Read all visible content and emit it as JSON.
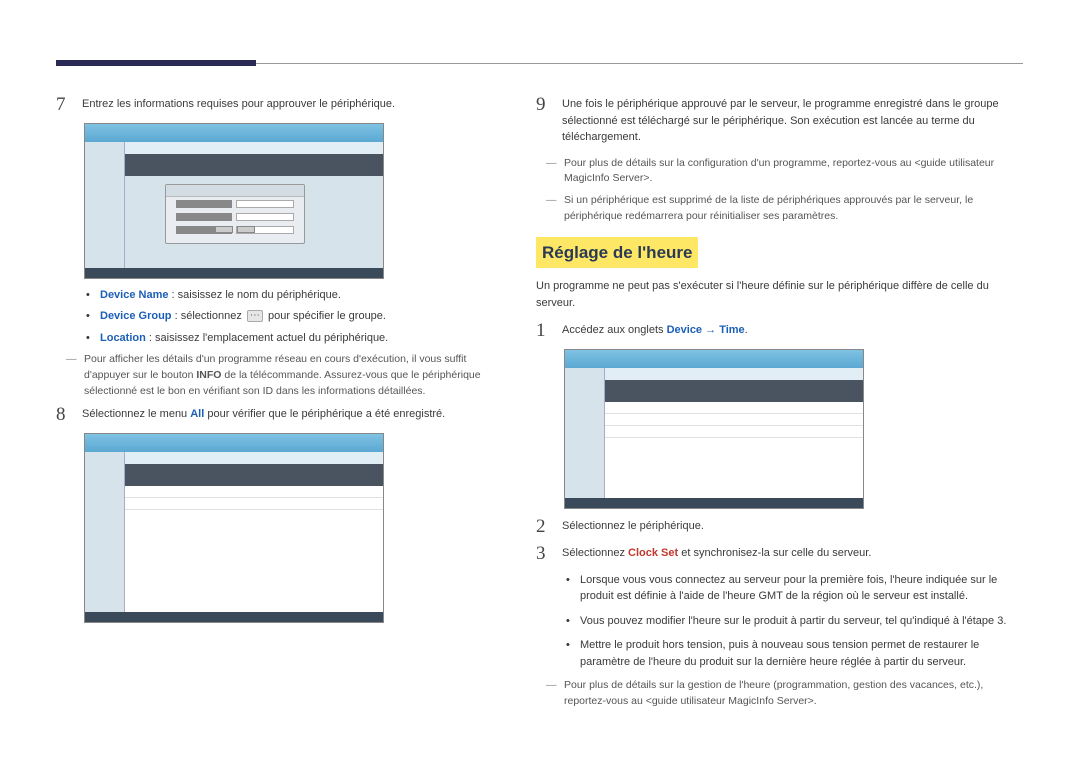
{
  "left": {
    "step7": {
      "num": "7",
      "text": "Entrez les informations requises pour approuver le périphérique."
    },
    "bullets7": [
      {
        "label": "Device Name",
        "rest": " : saisissez le nom du périphérique."
      },
      {
        "label": "Device Group",
        "rest_pre": " : sélectionnez ",
        "rest_post": " pour spécifier le groupe."
      },
      {
        "label": "Location",
        "rest": " : saisissez l'emplacement actuel du périphérique."
      }
    ],
    "note7": "Pour afficher les détails d'un programme réseau en cours d'exécution, il vous suffit d'appuyer sur le bouton INFO de la télécommande. Assurez-vous que le périphérique sélectionné est le bon en vérifiant son ID dans les informations détaillées.",
    "note7_bold": "INFO",
    "step8": {
      "num": "8",
      "text_pre": "Sélectionnez le menu ",
      "text_link": "All",
      "text_post": " pour vérifier que le périphérique a été enregistré."
    }
  },
  "right": {
    "step9": {
      "num": "9",
      "text": "Une fois le périphérique approuvé par le serveur, le programme enregistré dans le groupe sélectionné est téléchargé sur le périphérique. Son exécution est lancée au terme du téléchargement."
    },
    "note9a": "Pour plus de détails sur la configuration d'un programme, reportez-vous au <guide utilisateur MagicInfo Server>.",
    "note9b": "Si un périphérique est supprimé de la liste de périphériques approuvés par le serveur, le périphérique redémarrera pour réinitialiser ses paramètres.",
    "heading": "Réglage de l'heure",
    "intro": "Un programme ne peut pas s'exécuter si l'heure définie sur le périphérique diffère de celle du serveur.",
    "step1": {
      "num": "1",
      "text_pre": "Accédez aux onglets ",
      "link1": "Device",
      "arrow": " → ",
      "link2": "Time",
      "text_post": "."
    },
    "step2": {
      "num": "2",
      "text": "Sélectionnez le périphérique."
    },
    "step3": {
      "num": "3",
      "text_pre": "Sélectionnez ",
      "link": "Clock Set",
      "text_post": " et synchronisez-la sur celle du serveur."
    },
    "subbullets": [
      "Lorsque vous vous connectez au serveur pour la première fois, l'heure indiquée sur le produit est définie à l'aide de l'heure GMT de la région où le serveur est installé.",
      "Vous pouvez modifier l'heure sur le produit à partir du serveur, tel qu'indiqué à l'étape 3.",
      "Mettre le produit hors tension, puis à nouveau sous tension permet de restaurer le paramètre de l'heure du produit sur la dernière heure réglée à partir du serveur."
    ],
    "note_end": "Pour plus de détails sur la gestion de l'heure (programmation, gestion des vacances, etc.), reportez-vous au <guide utilisateur MagicInfo Server>."
  }
}
